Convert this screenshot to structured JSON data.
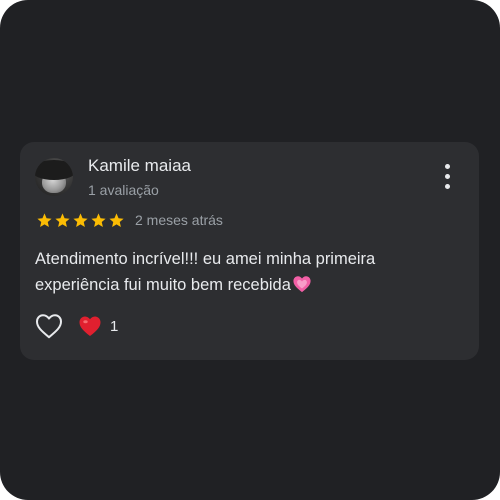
{
  "review": {
    "author_name": "Kamile maiaa",
    "review_count": "1 avaliação",
    "rating": 5,
    "rating_max": 5,
    "time_ago": "2 meses atrás",
    "text_line1": "Atendimento incrível!!! eu amei minha primeira",
    "text_line2": "experiência fui muito bem recebida",
    "reactions": {
      "count": "1"
    }
  },
  "icons": {
    "menu": "more-vert-icon",
    "like": "heart-outline-icon",
    "reaction": "red-heart-emoji",
    "text_emoji": "sparkling-heart-emoji",
    "star": "star-icon"
  },
  "colors": {
    "background": "#202124",
    "card": "#2d2e31",
    "primary_text": "#e8eaed",
    "secondary_text": "#9aa0a6",
    "star": "#fbbc04",
    "reaction_heart": "#e0202f",
    "emoji_pink": "#f25fa6"
  }
}
